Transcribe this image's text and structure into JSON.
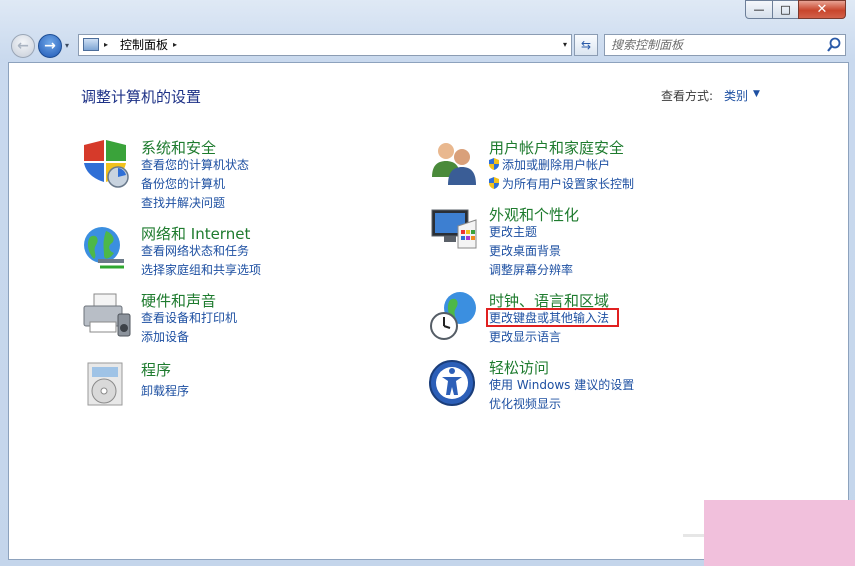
{
  "titlebar": {
    "minimize_label": "—",
    "maximize_label": "□",
    "close_label": "✕"
  },
  "nav": {
    "back_icon": "←",
    "forward_icon": "→",
    "recent_icon": "▾"
  },
  "address": {
    "separator_icon": "▸",
    "path_label": "控制面板",
    "dropdown_icon": "▾",
    "refresh_icon": "⇆"
  },
  "search": {
    "placeholder": "搜索控制面板"
  },
  "page": {
    "heading": "调整计算机的设置",
    "view_by_label": "查看方式:",
    "view_by_value": "类别",
    "view_by_arrow": "▼"
  },
  "categories": [
    {
      "title": "系统和安全",
      "icon": "system-security-shield-icon",
      "tasks": [
        "查看您的计算机状态",
        "备份您的计算机",
        "查找并解决问题"
      ]
    },
    {
      "title": "网络和 Internet",
      "icon": "network-globe-icon",
      "tasks": [
        "查看网络状态和任务",
        "选择家庭组和共享选项"
      ]
    },
    {
      "title": "硬件和声音",
      "icon": "printer-hardware-icon",
      "tasks": [
        "查看设备和打印机",
        "添加设备"
      ]
    },
    {
      "title": "程序",
      "icon": "programs-disc-icon",
      "tasks": [
        "卸载程序"
      ]
    },
    {
      "title": "用户帐户和家庭安全",
      "icon": "users-icon",
      "tasks": [
        "添加或删除用户帐户",
        "为所有用户设置家长控制"
      ]
    },
    {
      "title": "外观和个性化",
      "icon": "appearance-monitor-icon",
      "tasks": [
        "更改主题",
        "更改桌面背景",
        "调整屏幕分辨率"
      ]
    },
    {
      "title": "时钟、语言和区域",
      "icon": "clock-globe-icon",
      "tasks": [
        "更改键盘或其他输入法",
        "更改显示语言"
      ]
    },
    {
      "title": "轻松访问",
      "icon": "ease-of-access-icon",
      "tasks": [
        "使用 Windows 建议的设置",
        "优化视频显示"
      ]
    }
  ],
  "colors": {
    "category_title": "#1e7b2e",
    "task_link": "#1e50a2",
    "heading": "#1e3287",
    "highlight": "#e02020"
  }
}
